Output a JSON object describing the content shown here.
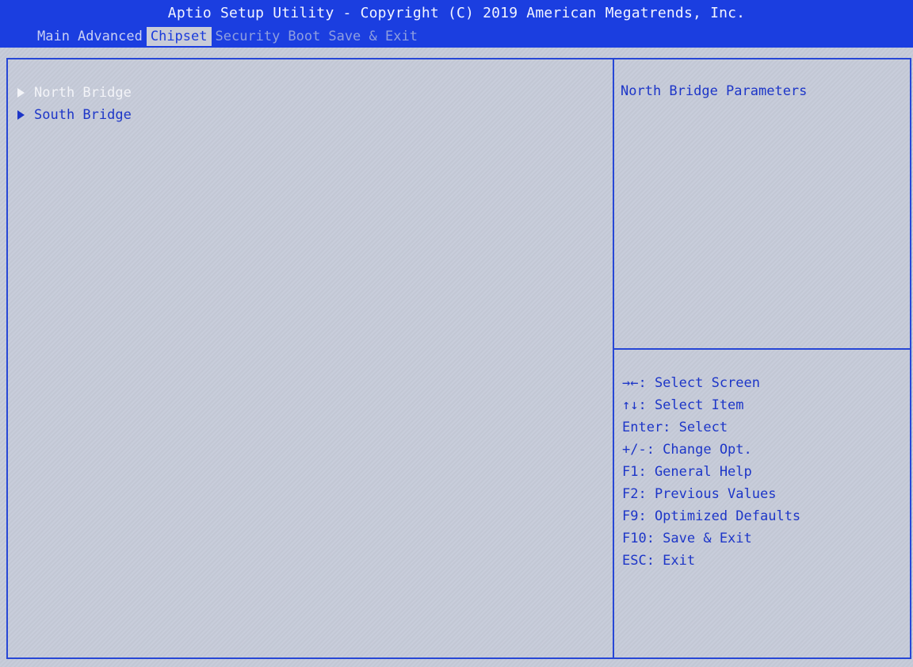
{
  "header": {
    "title": "Aptio Setup Utility - Copyright (C) 2019 American Megatrends, Inc.",
    "tabs": [
      {
        "label": "Main",
        "state": "normal"
      },
      {
        "label": "Advanced",
        "state": "normal"
      },
      {
        "label": "Chipset",
        "state": "active"
      },
      {
        "label": "Security",
        "state": "dim"
      },
      {
        "label": "Boot",
        "state": "dim"
      },
      {
        "label": "Save & Exit",
        "state": "dim"
      }
    ]
  },
  "menu": {
    "items": [
      {
        "label": "North Bridge",
        "selected": true
      },
      {
        "label": "South Bridge",
        "selected": false
      }
    ]
  },
  "help": {
    "description": "North Bridge Parameters",
    "keys": [
      "→←: Select Screen",
      "↑↓: Select Item",
      "Enter: Select",
      "+/-: Change Opt.",
      "F1: General Help",
      "F2: Previous Values",
      "F9: Optimized Defaults",
      "F10: Save & Exit",
      "ESC: Exit"
    ]
  },
  "colors": {
    "header_bg": "#1b3ee0",
    "accent": "#1d36c8",
    "panel_bg": "#c4c9d6",
    "selected_text": "#f3f4f8"
  }
}
